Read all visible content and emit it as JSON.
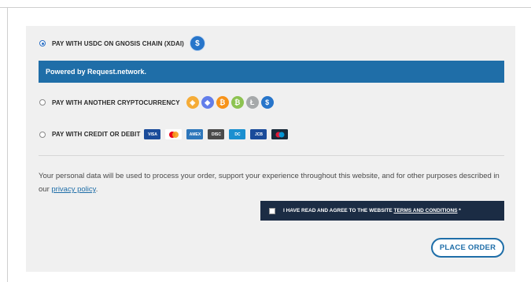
{
  "payment": {
    "option_usdc": {
      "label": "PAY WITH USDC ON GNOSIS CHAIN (XDAI)",
      "selected": true,
      "icon": "usdc-icon"
    },
    "powered_by": "Powered by Request.network.",
    "option_crypto": {
      "label": "PAY WITH ANOTHER CRYPTOCURRENCY",
      "selected": false,
      "icons": [
        {
          "name": "dai-icon",
          "color": "#f5ac37",
          "glyph": "◈"
        },
        {
          "name": "ethereum-icon",
          "color": "#627eea",
          "glyph": "◆"
        },
        {
          "name": "bitcoin-icon",
          "color": "#f7931a",
          "glyph": "₿"
        },
        {
          "name": "bitcoin-cash-icon",
          "color": "#8dc351",
          "glyph": "₿"
        },
        {
          "name": "litecoin-icon",
          "color": "#a6a9aa",
          "glyph": "Ł"
        },
        {
          "name": "usdc-icon",
          "color": "#2775ca",
          "glyph": "$"
        }
      ]
    },
    "option_card": {
      "label": "PAY WITH CREDIT OR DEBIT",
      "selected": false,
      "cards": [
        {
          "name": "visa-icon",
          "text": "VISA",
          "bg": "#1a4b9a"
        },
        {
          "name": "mastercard-icon",
          "text": "",
          "bg": "#ffffff"
        },
        {
          "name": "amex-icon",
          "text": "AMEX",
          "bg": "#2e77bb"
        },
        {
          "name": "discover-icon",
          "text": "DISC",
          "bg": "#4a4a4a"
        },
        {
          "name": "diners-club-icon",
          "text": "DC",
          "bg": "#1a8fd0"
        },
        {
          "name": "jcb-icon",
          "text": "JCB",
          "bg": "#1a4b9a"
        },
        {
          "name": "maestro-icon",
          "text": "",
          "bg": "#1a2a3a"
        }
      ]
    }
  },
  "privacy": {
    "text_before": "Your personal data will be used to process your order, support your experience throughout this website, and for other purposes described in our ",
    "link": "privacy policy",
    "text_after": "."
  },
  "terms": {
    "text": "I HAVE READ AND AGREE TO THE WEBSITE ",
    "link": "TERMS AND CONDITIONS",
    "required": " *",
    "checked": false
  },
  "place_order_label": "PLACE ORDER"
}
